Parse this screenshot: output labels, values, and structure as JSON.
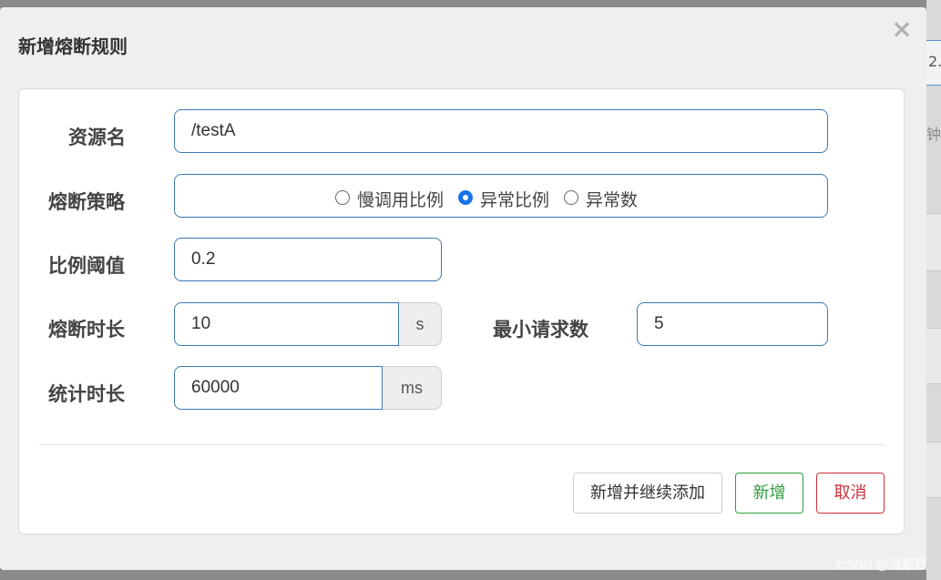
{
  "background": {
    "peek_input_text": "2.",
    "peek_text": "钟"
  },
  "dialog": {
    "title": "新增熔断规则",
    "close_glyph": "×"
  },
  "form": {
    "resource_name": {
      "label": "资源名",
      "value": "/testA"
    },
    "strategy": {
      "label": "熔断策略",
      "options": [
        "慢调用比例",
        "异常比例",
        "异常数"
      ],
      "selected": "异常比例"
    },
    "ratio_threshold": {
      "label": "比例阈值",
      "value": "0.2"
    },
    "break_duration": {
      "label": "熔断时长",
      "value": "10",
      "unit": "s"
    },
    "min_requests": {
      "label": "最小请求数",
      "value": "5"
    },
    "stat_duration": {
      "label": "统计时长",
      "value": "60000",
      "unit": "ms"
    }
  },
  "buttons": {
    "add_continue": "新增并继续添加",
    "add": "新增",
    "cancel": "取消"
  },
  "colors": {
    "accent": "#3c78b4",
    "success": "#2e9e3e",
    "danger": "#c9303a",
    "radio_checked": "#1a73e8"
  },
  "watermark": "CSDN @流烟默"
}
